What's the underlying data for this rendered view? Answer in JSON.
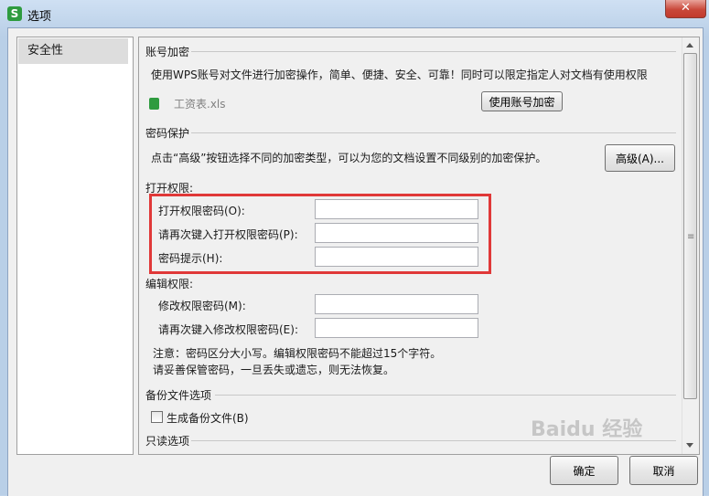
{
  "window": {
    "title": "选项",
    "app_icon": "S",
    "close_label": "✕"
  },
  "nav": {
    "items": [
      {
        "label": "安全性",
        "selected": true
      }
    ]
  },
  "account_encrypt": {
    "title": "账号加密",
    "description": "使用WPS账号对文件进行加密操作，简单、便捷、安全、可靠！同时可以限定指定人对文档有使用权限",
    "file_name": "工资表.xls",
    "button_label": "使用账号加密"
  },
  "password_protect": {
    "title": "密码保护",
    "description": "点击“高级”按钮选择不同的加密类型，可以为您的文档设置不同级别的加密保护。",
    "advanced_label": "高级(A)..."
  },
  "open_permission": {
    "title": "打开权限:",
    "fields": [
      {
        "label": "打开权限密码(O):",
        "value": ""
      },
      {
        "label": "请再次键入打开权限密码(P):",
        "value": ""
      },
      {
        "label": "密码提示(H):",
        "value": ""
      }
    ]
  },
  "edit_permission": {
    "title": "编辑权限:",
    "fields": [
      {
        "label": "修改权限密码(M):",
        "value": ""
      },
      {
        "label": "请再次键入修改权限密码(E):",
        "value": ""
      }
    ]
  },
  "notes": {
    "line1": "注意：密码区分大小写。编辑权限密码不能超过15个字符。",
    "line2": "请妥善保管密码，一旦丢失或遗忘，则无法恢复。"
  },
  "backup": {
    "title": "备份文件选项",
    "checkbox_label": "生成备份文件(B)",
    "checked": false
  },
  "readonly": {
    "title": "只读选项"
  },
  "footer": {
    "ok_label": "确定",
    "cancel_label": "取消"
  },
  "watermark": "Baidu 经验",
  "colors": {
    "highlight": "#e03838",
    "close": "#c9483a",
    "app_icon": "#2e9b3f"
  }
}
